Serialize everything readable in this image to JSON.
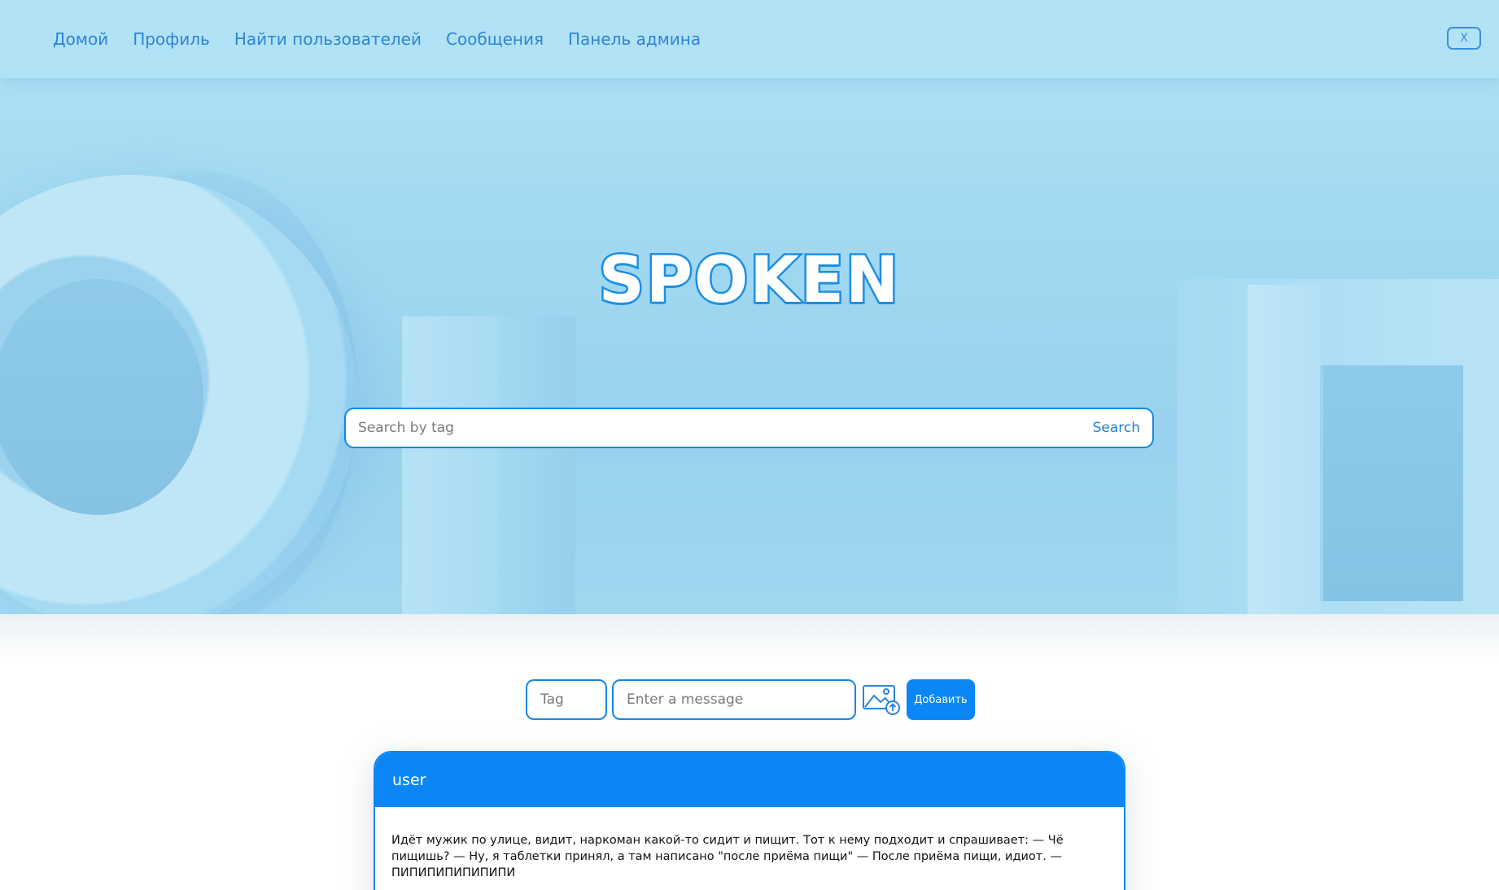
{
  "nav": {
    "links": [
      "Домой",
      "Профиль",
      "Найти пользователей",
      "Сообщения",
      "Панель админа"
    ],
    "close_label": "X"
  },
  "hero": {
    "logo": "SPOKEN",
    "search": {
      "placeholder": "Search by tag",
      "button_label": "Search"
    }
  },
  "composer": {
    "tag_placeholder": "Tag",
    "message_placeholder": "Enter a message",
    "image_icon": "image-upload-icon",
    "add_label": "Добавить"
  },
  "post": {
    "author": "user",
    "text": "Идёт мужик по улице, видит, наркоман какой-то сидит и пищит. Тот к нему подходит и спрашивает: — Чё пищишь? — Ну, я таблетки принял, а там написано \"после приёма пищи\" — После приёма пищи, идиот. — ПИПИПИПИПИПИПИ"
  },
  "colors": {
    "accent": "#0a87f5",
    "link": "#2e84d9",
    "hero_bg": "#a3d9f1"
  }
}
